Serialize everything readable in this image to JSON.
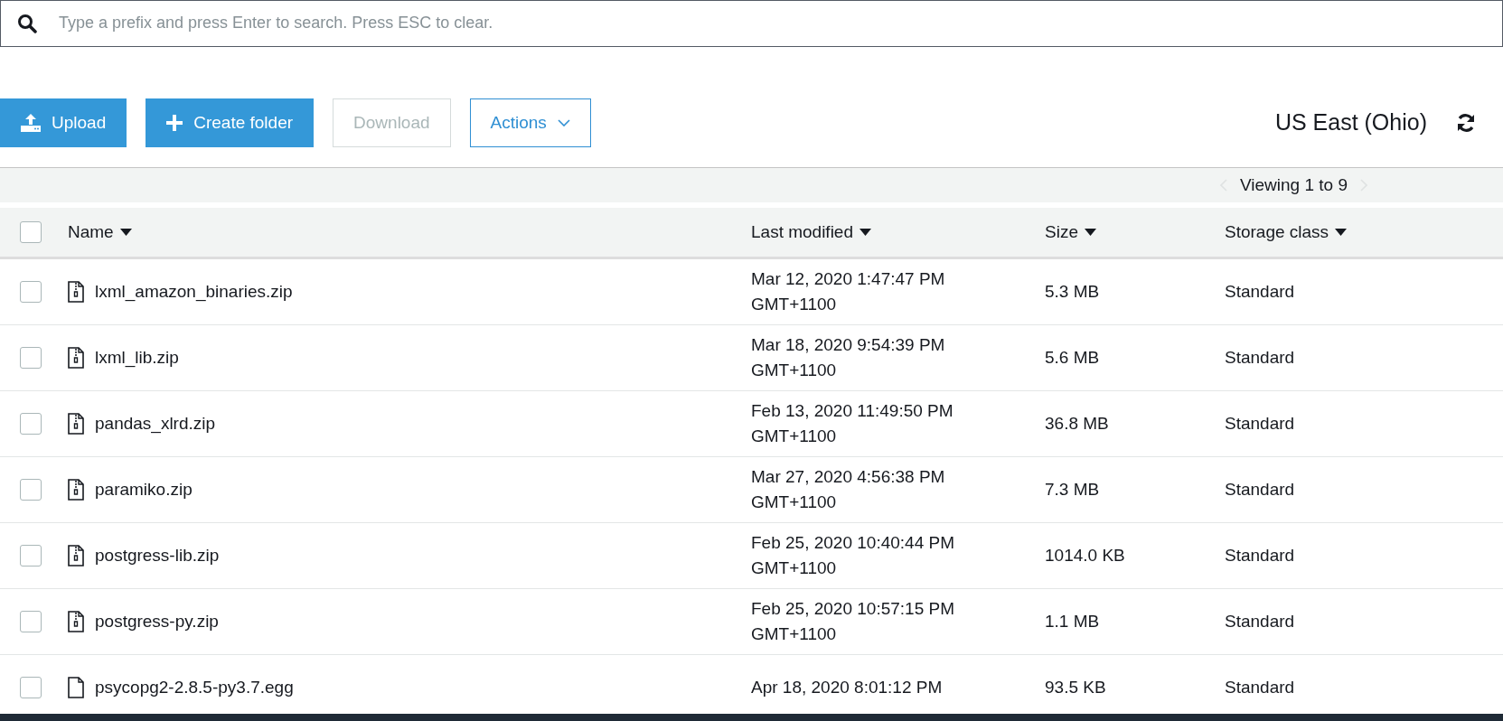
{
  "search": {
    "placeholder": "Type a prefix and press Enter to search. Press ESC to clear."
  },
  "toolbar": {
    "buttons": [
      {
        "label": "Upload",
        "kind": "upload",
        "disabled": false
      },
      {
        "label": "Create folder",
        "kind": "create",
        "disabled": false
      },
      {
        "label": "Download",
        "kind": "plain",
        "disabled": true
      },
      {
        "label": "Actions",
        "kind": "dropdown",
        "disabled": false
      }
    ],
    "region": "US East (Ohio)"
  },
  "pager": {
    "text": "Viewing 1 to 9"
  },
  "table": {
    "select_all_checked": false,
    "columns": [
      "Name",
      "Last modified",
      "Size",
      "Storage class"
    ],
    "rows": [
      {
        "name": "lxml_amazon_binaries.zip",
        "kind": "zip",
        "date": "Mar 12, 2020 1:47:47 PM",
        "tz": "GMT+1100",
        "size": "5.3 MB",
        "storage": "Standard",
        "checked": false
      },
      {
        "name": "lxml_lib.zip",
        "kind": "zip",
        "date": "Mar 18, 2020 9:54:39 PM",
        "tz": "GMT+1100",
        "size": "5.6 MB",
        "storage": "Standard",
        "checked": false
      },
      {
        "name": "pandas_xlrd.zip",
        "kind": "zip",
        "date": "Feb 13, 2020 11:49:50 PM",
        "tz": "GMT+1100",
        "size": "36.8 MB",
        "storage": "Standard",
        "checked": false
      },
      {
        "name": "paramiko.zip",
        "kind": "zip",
        "date": "Mar 27, 2020 4:56:38 PM",
        "tz": "GMT+1100",
        "size": "7.3 MB",
        "storage": "Standard",
        "checked": false
      },
      {
        "name": "postgress-lib.zip",
        "kind": "zip",
        "date": "Feb 25, 2020 10:40:44 PM",
        "tz": "GMT+1100",
        "size": "1014.0 KB",
        "storage": "Standard",
        "checked": false
      },
      {
        "name": "postgress-py.zip",
        "kind": "zip",
        "date": "Feb 25, 2020 10:57:15 PM",
        "tz": "GMT+1100",
        "size": "1.1 MB",
        "storage": "Standard",
        "checked": false
      },
      {
        "name": "psycopg2-2.8.5-py3.7.egg",
        "kind": "file",
        "date": "Apr 18, 2020 8:01:12 PM",
        "size": "93.5 KB",
        "storage": "Standard",
        "checked": false
      }
    ]
  }
}
